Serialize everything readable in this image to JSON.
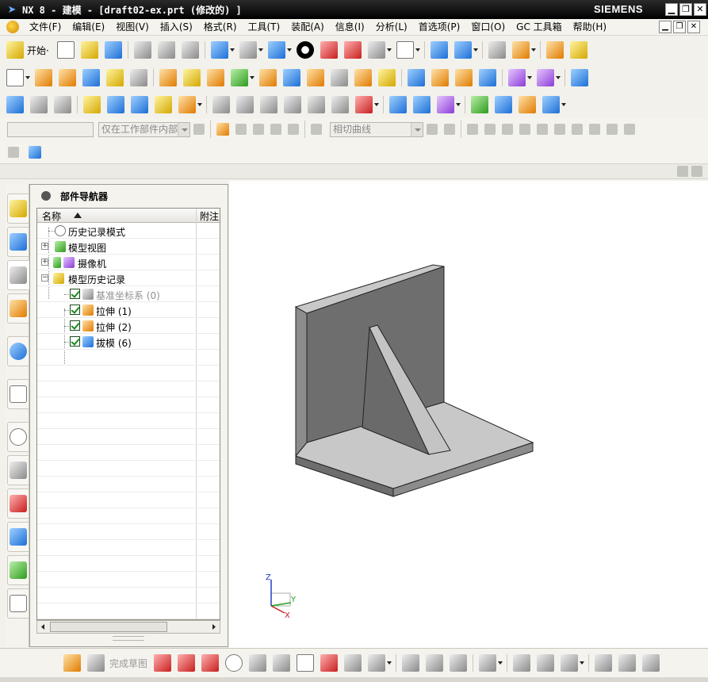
{
  "window": {
    "title": "NX 8 - 建模 - [draft02-ex.prt (修改的) ]",
    "brand": "SIEMENS",
    "minimize_glyph": "▁",
    "restore_glyph": "❐",
    "close_glyph": "✕"
  },
  "menubar": {
    "items": [
      "文件(F)",
      "编辑(E)",
      "视图(V)",
      "插入(S)",
      "格式(R)",
      "工具(T)",
      "装配(A)",
      "信息(I)",
      "分析(L)",
      "首选项(P)",
      "窗口(O)",
      "GC 工具箱",
      "帮助(H)"
    ]
  },
  "toolbar": {
    "start_label": "开始·"
  },
  "selection_bar": {
    "type_filter_value": "",
    "scope_value": "仅在工作部件内部",
    "curve_rule_value": "相切曲线"
  },
  "navigator": {
    "title": "部件导航器",
    "col_name": "名称",
    "col_attach": "附注",
    "rows": [
      {
        "label": "历史记录模式",
        "icon": "clock-icon"
      },
      {
        "label": "模型视图",
        "icon": "model-view-icon",
        "expander": "+"
      },
      {
        "label": "摄像机",
        "icon": "camera-icon",
        "expander": "+"
      },
      {
        "label": "模型历史记录",
        "icon": "folder-icon",
        "expander": "−"
      },
      {
        "label": "基准坐标系 (0)",
        "icon": "datum-csys-icon",
        "checked": true,
        "dim": true
      },
      {
        "label": "拉伸 (1)",
        "icon": "extrude-icon",
        "checked": true
      },
      {
        "label": "拉伸 (2)",
        "icon": "extrude-icon",
        "checked": true
      },
      {
        "label": "拔模 (6)",
        "icon": "draft-icon",
        "checked": true
      }
    ]
  },
  "triad": {
    "z_label": "Z",
    "y_label": "Y",
    "x_label": "X"
  },
  "bottom_toolbar": {
    "finish_sketch_label": "完成草图"
  },
  "colors": {
    "titlebar": "#000000",
    "model_face_dark": "#6e6e6e",
    "model_face_mid": "#8c8c8c",
    "model_face_light": "#c8c8c8"
  }
}
